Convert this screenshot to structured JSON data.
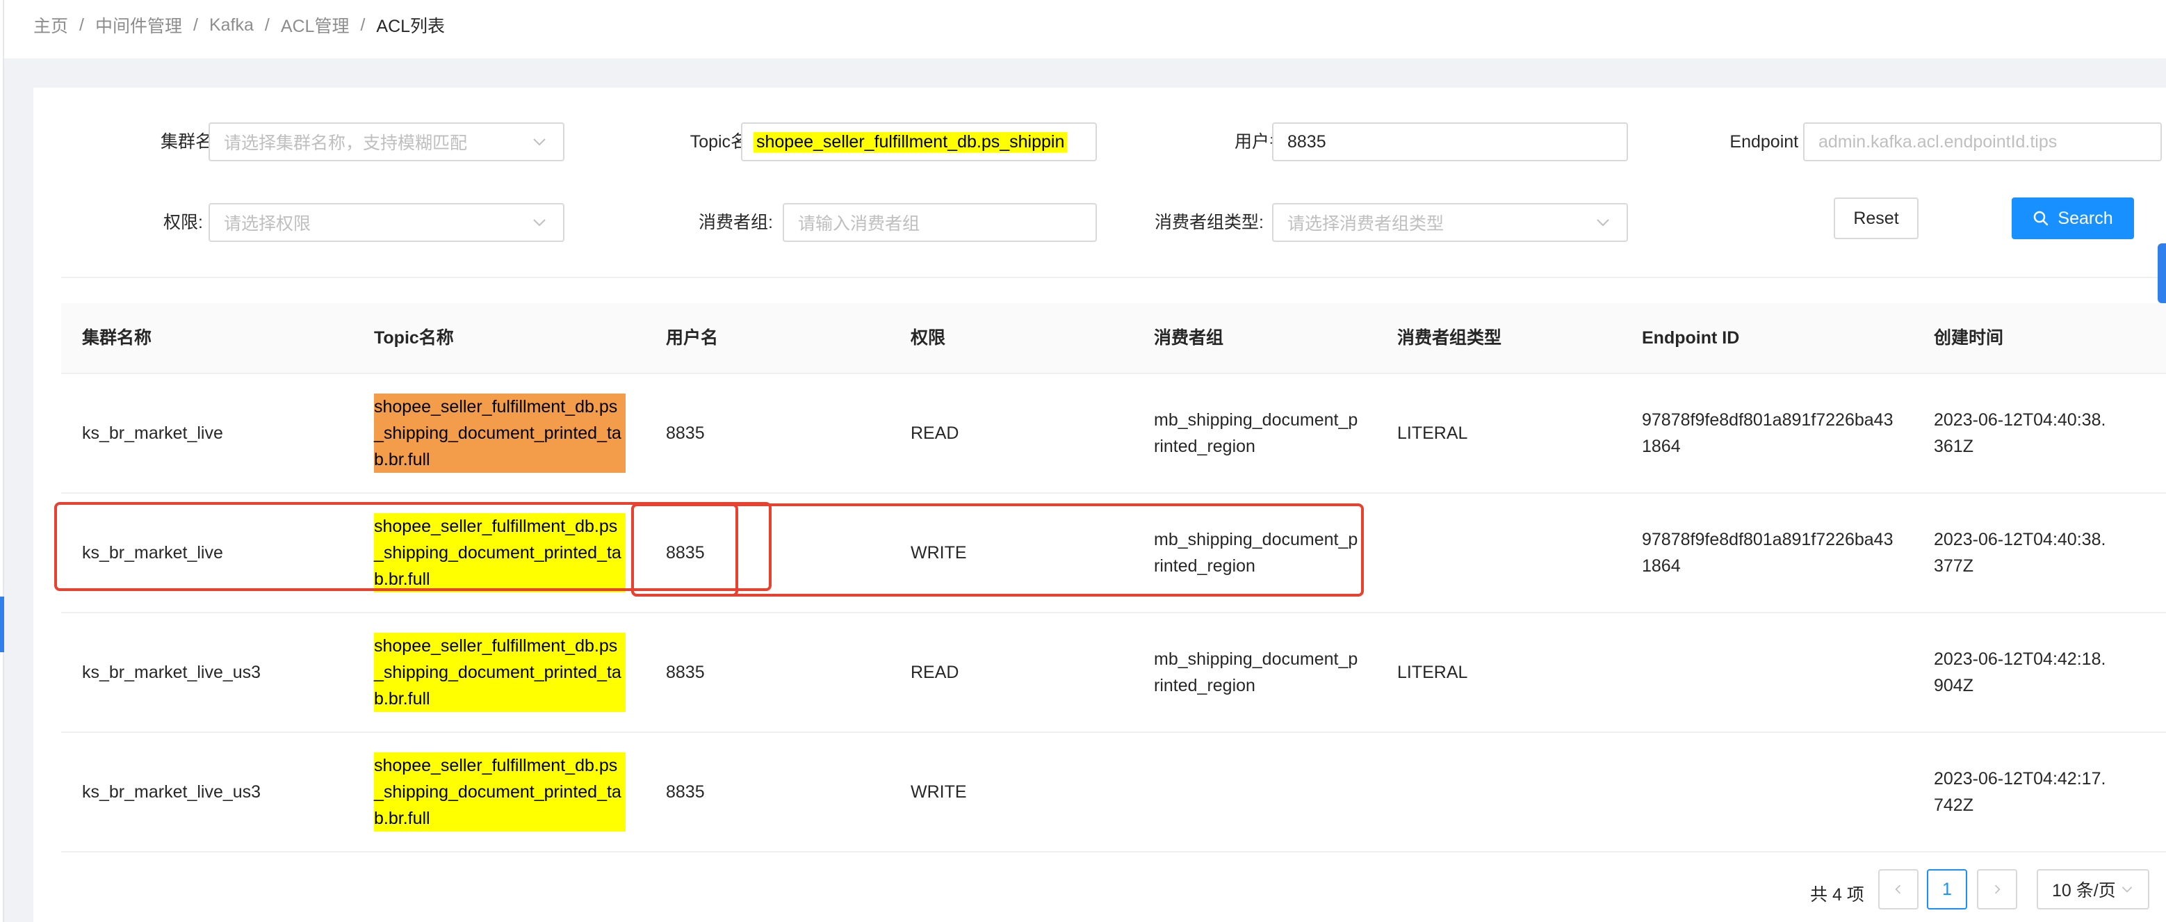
{
  "breadcrumb": [
    "主页",
    "中间件管理",
    "Kafka",
    "ACL管理",
    "ACL列表"
  ],
  "filters": {
    "cluster": {
      "label": "集群名称:",
      "placeholder": "请选择集群名称，支持模糊匹配"
    },
    "topic": {
      "label": "Topic名称:",
      "value": "shopee_seller_fulfillment_db.ps_shippin"
    },
    "username": {
      "label": "用户名:",
      "value": "8835"
    },
    "endpoint": {
      "label": "Endpoint ID:",
      "placeholder": "admin.kafka.acl.endpointId.tips"
    },
    "permission": {
      "label": "权限:",
      "placeholder": "请选择权限"
    },
    "consumer_group": {
      "label": "消费者组:",
      "placeholder": "请输入消费者组"
    },
    "consumer_group_type": {
      "label": "消费者组类型:",
      "placeholder": "请选择消费者组类型"
    }
  },
  "buttons": {
    "reset": "Reset",
    "search": "Search"
  },
  "colors": {
    "primary": "#1890ff",
    "highlight_yellow": "#ffff00",
    "highlight_orange": "#f39c4a",
    "annotation_red": "#e8412f"
  },
  "table": {
    "columns": [
      "集群名称",
      "Topic名称",
      "用户名",
      "权限",
      "消费者组",
      "消费者组类型",
      "Endpoint ID",
      "创建时间"
    ],
    "rows": [
      {
        "cluster": "ks_br_market_live",
        "topic": "shopee_seller_fulfillment_db.ps_shipping_document_printed_tab.br.full",
        "topic_highlight": "orange",
        "user": "8835",
        "permission": "READ",
        "consumer_group": "mb_shipping_document_printed_region",
        "consumer_group_type": "LITERAL",
        "endpoint": "97878f9fe8df801a891f7226ba431864",
        "created": "2023-06-12T04:40:38.361Z"
      },
      {
        "cluster": "ks_br_market_live",
        "topic": "shopee_seller_fulfillment_db.ps_shipping_document_printed_tab.br.full",
        "topic_highlight": "yellow",
        "user": "8835",
        "permission": "WRITE",
        "consumer_group": "mb_shipping_document_printed_region",
        "consumer_group_type": "",
        "endpoint": "97878f9fe8df801a891f7226ba431864",
        "created": "2023-06-12T04:40:38.377Z"
      },
      {
        "cluster": "ks_br_market_live_us3",
        "topic": "shopee_seller_fulfillment_db.ps_shipping_document_printed_tab.br.full",
        "topic_highlight": "yellow",
        "user": "8835",
        "permission": "READ",
        "consumer_group": "mb_shipping_document_printed_region",
        "consumer_group_type": "LITERAL",
        "endpoint": "",
        "created": "2023-06-12T04:42:18.904Z"
      },
      {
        "cluster": "ks_br_market_live_us3",
        "topic": "shopee_seller_fulfillment_db.ps_shipping_document_printed_tab.br.full",
        "topic_highlight": "yellow",
        "user": "8835",
        "permission": "WRITE",
        "consumer_group": "",
        "consumer_group_type": "",
        "endpoint": "",
        "created": "2023-06-12T04:42:17.742Z"
      }
    ]
  },
  "pagination": {
    "total": "共 4 项",
    "current_page": "1",
    "page_size": "10 条/页"
  },
  "icons": {
    "select_arrow": "chevron-down-icon",
    "search": "search-icon",
    "prev": "chevron-left-icon",
    "next": "chevron-right-icon"
  }
}
